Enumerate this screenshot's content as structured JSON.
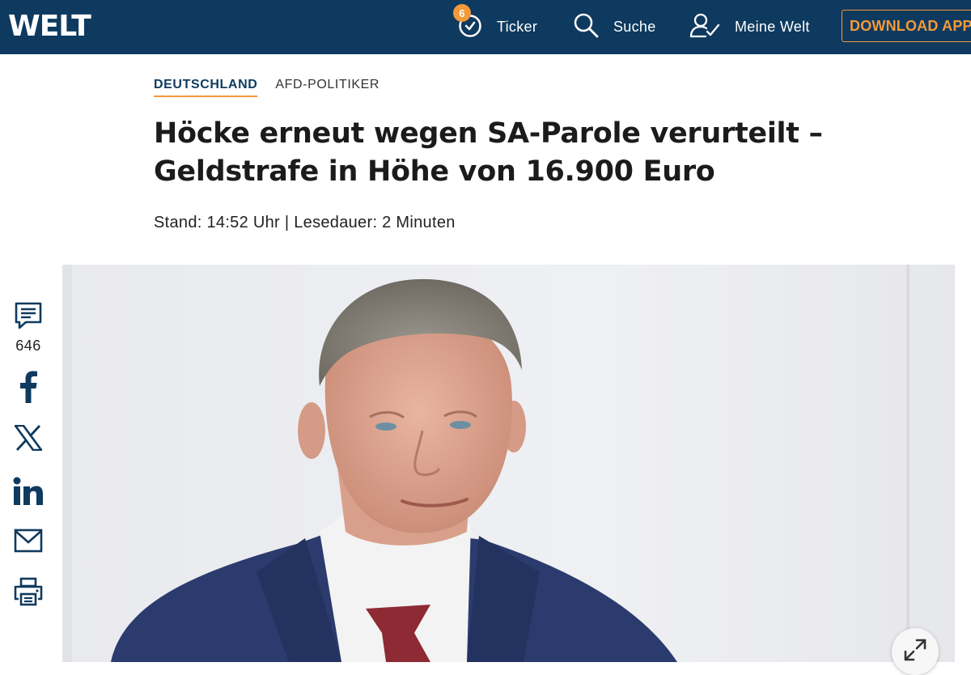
{
  "header": {
    "logo": "WELT",
    "ticker_badge": "6",
    "ticker_label": "Ticker",
    "search_label": "Suche",
    "account_label": "Meine Welt",
    "download_label": "DOWNLOAD APP"
  },
  "breadcrumb": {
    "section": "DEUTSCHLAND",
    "topic": "AFD-POLITIKER"
  },
  "article": {
    "title": "Höcke erneut wegen SA-Parole verurteilt – Geldstrafe in Höhe von 16.900 Euro",
    "meta": "Stand: 14:52 Uhr | Lesedauer: 2 Minuten"
  },
  "share": {
    "comment_count": "646",
    "icons": [
      "comment-icon",
      "facebook-icon",
      "x-icon",
      "linkedin-icon",
      "mail-icon",
      "print-icon"
    ]
  },
  "colors": {
    "brand": "#0f3a5f",
    "accent": "#f29a39"
  }
}
